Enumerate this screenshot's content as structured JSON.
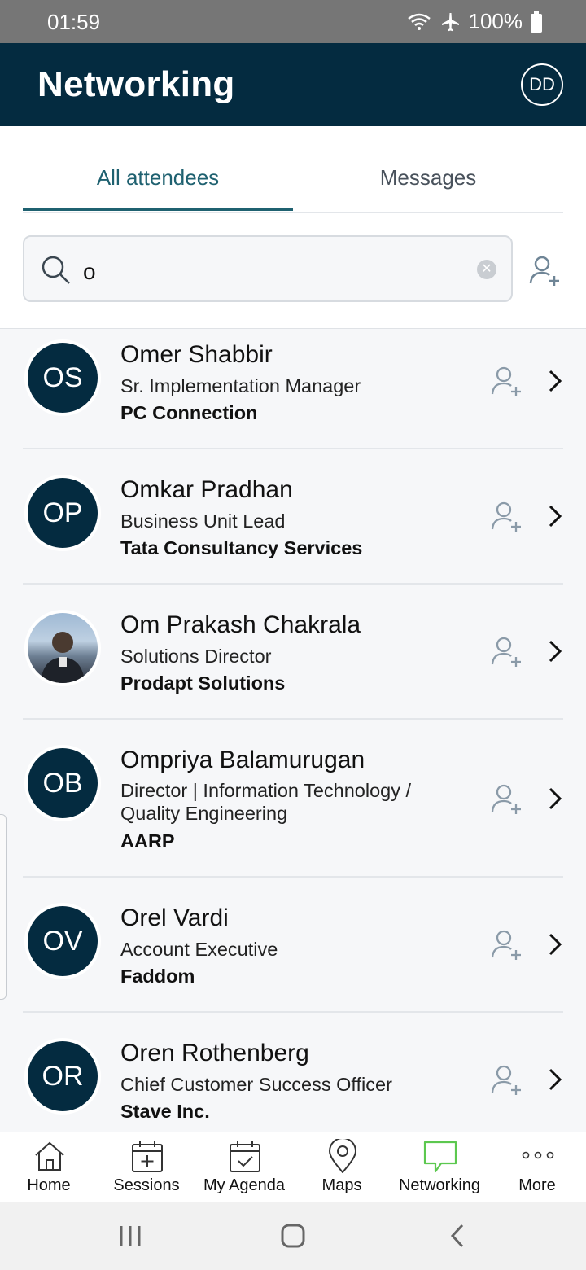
{
  "status_bar": {
    "time": "01:59",
    "battery": "100%"
  },
  "header": {
    "title": "Networking",
    "avatar_initials": "DD"
  },
  "tabs": [
    {
      "label": "All attendees",
      "active": true
    },
    {
      "label": "Messages",
      "active": false
    }
  ],
  "search": {
    "value": "o"
  },
  "attendees": [
    {
      "initials": "OS",
      "name": "Omer Shabbir",
      "title": "Sr. Implementation Manager",
      "company": "PC Connection"
    },
    {
      "initials": "OP",
      "name": "Omkar Pradhan",
      "title": "Business Unit Lead",
      "company": "Tata Consultancy Services"
    },
    {
      "initials": "",
      "name": "Om Prakash Chakrala",
      "title": "Solutions Director",
      "company": "Prodapt Solutions",
      "has_photo": true
    },
    {
      "initials": "OB",
      "name": "Ompriya Balamurugan",
      "title": "Director | Information Technology / Quality Engineering",
      "company": "AARP"
    },
    {
      "initials": "OV",
      "name": "Orel Vardi",
      "title": "Account Executive",
      "company": "Faddom"
    },
    {
      "initials": "OR",
      "name": "Oren Rothenberg",
      "title": "Chief Customer Success Officer",
      "company": "Stave Inc."
    }
  ],
  "bottom_nav": [
    {
      "label": "Home",
      "icon": "home-icon"
    },
    {
      "label": "Sessions",
      "icon": "calendar-plus-icon"
    },
    {
      "label": "My Agenda",
      "icon": "calendar-check-icon"
    },
    {
      "label": "Maps",
      "icon": "map-pin-icon"
    },
    {
      "label": "Networking",
      "icon": "chat-bubble-icon",
      "active": true
    },
    {
      "label": "More",
      "icon": "more-dots-icon"
    }
  ],
  "colors": {
    "header_bg": "#042b40",
    "tab_active": "#1f6170",
    "networking_active": "#5cc84f",
    "avatar_bg": "#042b40"
  }
}
